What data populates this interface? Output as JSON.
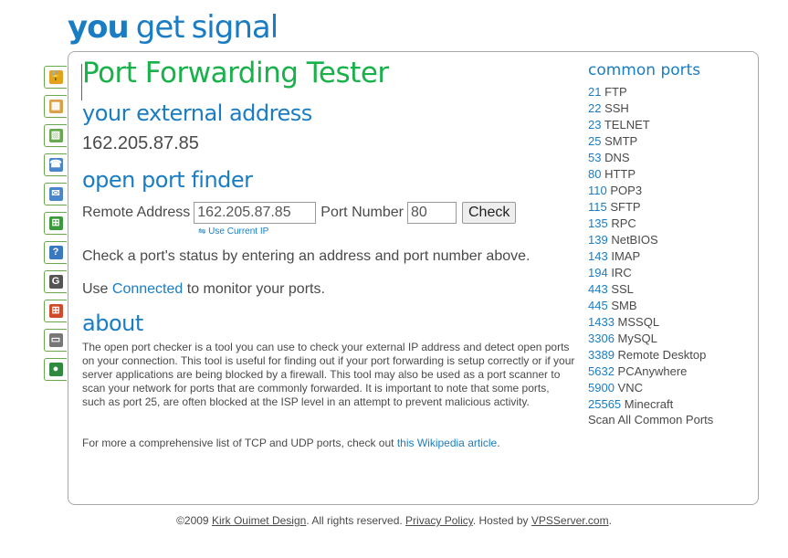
{
  "logo": {
    "you": "you",
    "get": "get",
    "signal": "signal"
  },
  "page_title": "Port Forwarding Tester",
  "sections": {
    "external": "your external address",
    "finder": "open port finder",
    "about": "about"
  },
  "external_ip": "162.205.87.85",
  "finder": {
    "remote_label": "Remote Address",
    "remote_value": "162.205.87.85",
    "port_label": "Port Number",
    "port_value": "80",
    "check_label": "Check",
    "use_current_ip": "Use Current IP"
  },
  "status_text": "Check a port's status by entering an address and port number above.",
  "connected": {
    "prefix": "Use",
    "link": "Connected",
    "suffix": "to monitor your ports."
  },
  "about_text": "The open port checker is a tool you can use to check your external IP address and detect open ports on your connection. This tool is useful for finding out if your port forwarding is setup correctly or if your server applications are being blocked by a firewall. This tool may also be used as a port scanner to scan your network for ports that are commonly forwarded. It is important to note that some ports, such as port 25, are often blocked at the ISP level in an attempt to prevent malicious activity.",
  "more_info": {
    "prefix": "For more a comprehensive list of TCP and UDP ports, check out",
    "link": "this Wikipedia article",
    "suffix": "."
  },
  "common_ports_title": "common ports",
  "common_ports": [
    {
      "port": "21",
      "name": "FTP"
    },
    {
      "port": "22",
      "name": "SSH"
    },
    {
      "port": "23",
      "name": "TELNET"
    },
    {
      "port": "25",
      "name": "SMTP"
    },
    {
      "port": "53",
      "name": "DNS"
    },
    {
      "port": "80",
      "name": "HTTP"
    },
    {
      "port": "110",
      "name": "POP3"
    },
    {
      "port": "115",
      "name": "SFTP"
    },
    {
      "port": "135",
      "name": "RPC"
    },
    {
      "port": "139",
      "name": "NetBIOS"
    },
    {
      "port": "143",
      "name": "IMAP"
    },
    {
      "port": "194",
      "name": "IRC"
    },
    {
      "port": "443",
      "name": "SSL"
    },
    {
      "port": "445",
      "name": "SMB"
    },
    {
      "port": "1433",
      "name": "MSSQL"
    },
    {
      "port": "3306",
      "name": "MySQL"
    },
    {
      "port": "3389",
      "name": "Remote Desktop"
    },
    {
      "port": "5632",
      "name": "PCAnywhere"
    },
    {
      "port": "5900",
      "name": "VNC"
    },
    {
      "port": "25565",
      "name": "Minecraft"
    }
  ],
  "scan_all": "Scan All Common Ports",
  "footer": {
    "copy": "©2009",
    "author": "Kirk Ouimet Design",
    "rights": ". All rights reserved.",
    "privacy": "Privacy Policy",
    "hosted": ". Hosted by",
    "host": "VPSServer.com",
    "end": "."
  },
  "sidebar_icons": [
    {
      "name": "lock-icon",
      "color": "#e6a020",
      "glyph": "🔓"
    },
    {
      "name": "map-icon",
      "color": "#d9a24a",
      "glyph": "▦"
    },
    {
      "name": "map-pin-icon",
      "color": "#6aa84f",
      "glyph": "▧"
    },
    {
      "name": "phone-icon",
      "color": "#4a86c8",
      "glyph": "☎"
    },
    {
      "name": "mail-icon",
      "color": "#4a86c8",
      "glyph": "✉"
    },
    {
      "name": "network-icon",
      "color": "#3b9a3b",
      "glyph": "⊞"
    },
    {
      "name": "help-icon",
      "color": "#3a78c0",
      "glyph": "?"
    },
    {
      "name": "google-icon",
      "color": "#555555",
      "glyph": "G"
    },
    {
      "name": "windows-icon",
      "color": "#d04a2a",
      "glyph": "⊞"
    },
    {
      "name": "drive-icon",
      "color": "#777777",
      "glyph": "▭"
    },
    {
      "name": "globe-icon",
      "color": "#2f8a3f",
      "glyph": "●"
    }
  ]
}
